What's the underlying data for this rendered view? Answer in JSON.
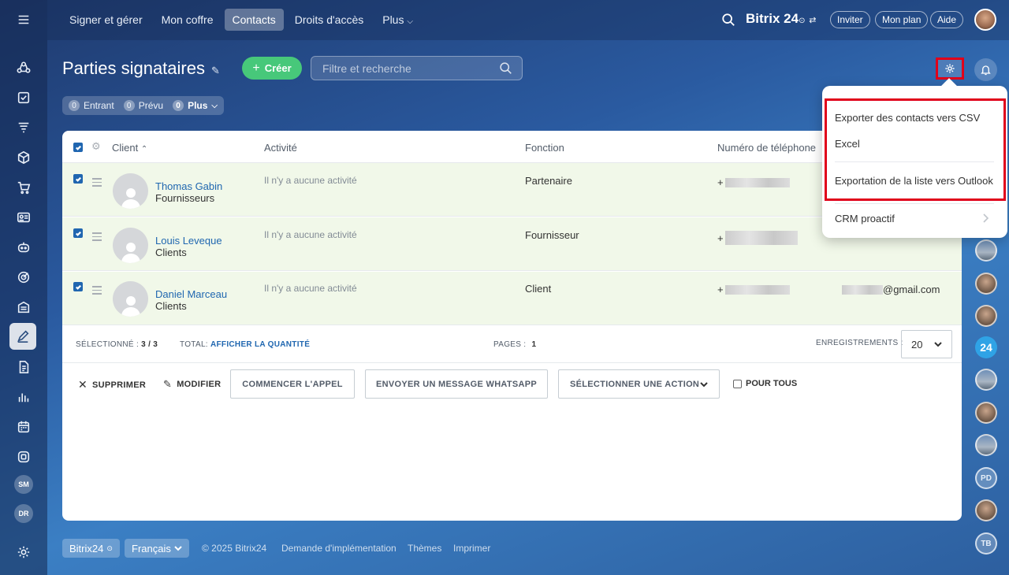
{
  "top_nav": [
    "Signer et gérer",
    "Mon coffre",
    "Contacts",
    "Droits d'accès",
    "Plus"
  ],
  "brand": {
    "name": "Bitrix 24",
    "sup": "⊙"
  },
  "top_buttons": {
    "invite": "Inviter",
    "plan": "Mon plan",
    "help": "Aide"
  },
  "page": {
    "title": "Parties signataires",
    "create_label": "Créer",
    "filter_placeholder": "Filtre et recherche"
  },
  "counters": [
    {
      "count": "0",
      "label": "Entrant"
    },
    {
      "count": "0",
      "label": "Prévu"
    },
    {
      "count": "0",
      "label": "Plus"
    }
  ],
  "table": {
    "headers": {
      "client": "Client",
      "activity": "Activité",
      "function": "Fonction",
      "phone": "Numéro de téléphone"
    },
    "rows": [
      {
        "name": "Thomas Gabin",
        "category": "Fournisseurs",
        "activity": "Il n'y a aucune activité",
        "function": "Partenaire",
        "phone_prefix": "+",
        "email": ""
      },
      {
        "name": "Louis Leveque",
        "category": "Clients",
        "activity": "Il n'y a aucune activité",
        "function": "Fournisseur",
        "phone_prefix": "+",
        "email": ""
      },
      {
        "name": "Daniel Marceau",
        "category": "Clients",
        "activity": "Il n'y a aucune activité",
        "function": "Client",
        "phone_prefix": "+",
        "email": "@gmail.com"
      }
    ]
  },
  "footer": {
    "selected_label": "SÉLECTIONNÉ :",
    "selected_value": "3 / 3",
    "total_label": "TOTAL:",
    "total_link": "AFFICHER LA QUANTITÉ",
    "pages_label": "PAGES :",
    "pages_value": "1",
    "records_label": "ENREGISTREMENTS :",
    "records_value": "20"
  },
  "actions": {
    "delete": "SUPPRIMER",
    "edit": "MODIFIER",
    "call": "COMMENCER L'APPEL",
    "whatsapp": "ENVOYER UN MESSAGE WHATSAPP",
    "select_action": "SÉLECTIONNER UNE ACTION",
    "for_all": "POUR TOUS"
  },
  "menu": {
    "export_csv": "Exporter des contacts vers CSV",
    "excel": "Excel",
    "outlook": "Exportation de la liste vers Outlook",
    "crm": "CRM proactif"
  },
  "sidebar_avatars": [
    "SM",
    "DR"
  ],
  "right_avatars": [
    "24",
    "PD",
    "TB"
  ],
  "bottom": {
    "brand": "Bitrix24",
    "language": "Français",
    "copyright": "© 2025 Bitrix24",
    "impl": "Demande d'implémentation",
    "themes": "Thèmes",
    "print": "Imprimer"
  },
  "colors": {
    "accent_blue": "#2067b0",
    "create_green": "#47c87a",
    "highlight_red": "#e0001a",
    "row_bg": "#f1f8e9"
  }
}
